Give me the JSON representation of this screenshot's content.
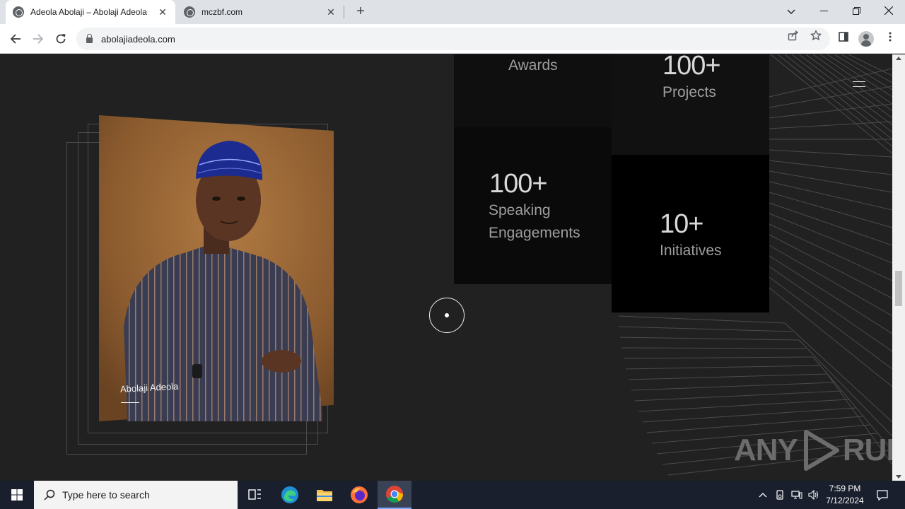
{
  "browser": {
    "tabs": [
      {
        "title": "Adeola Abolaji – Abolaji Adeola",
        "active": true
      },
      {
        "title": "mczbf.com",
        "active": false
      }
    ],
    "new_tab_icon": "plus-icon",
    "window_controls": {
      "minimize": "—",
      "restore": "❐",
      "close": "✕",
      "dropdown": "⌄"
    },
    "address": "abolajiadeola.com"
  },
  "page": {
    "stats": [
      {
        "number": "",
        "label": "Awards"
      },
      {
        "number": "100+",
        "label": "Projects"
      },
      {
        "number": "100+",
        "label": "Speaking Engagements"
      },
      {
        "number": "10+",
        "label": "Initiatives"
      }
    ],
    "portrait_name": "Abolaji Adeola",
    "watermark_left": "ANY",
    "watermark_right": "RUN"
  },
  "taskbar": {
    "search_placeholder": "Type here to search",
    "time": "7:59 PM",
    "date": "7/12/2024"
  },
  "colors": {
    "page_bg": "#212121",
    "stat_box_dark": "#0a0a0a",
    "stat_box_black": "#000000",
    "chrome_tab_strip": "#dee1e6",
    "taskbar_bg": "#1a1f2e"
  }
}
